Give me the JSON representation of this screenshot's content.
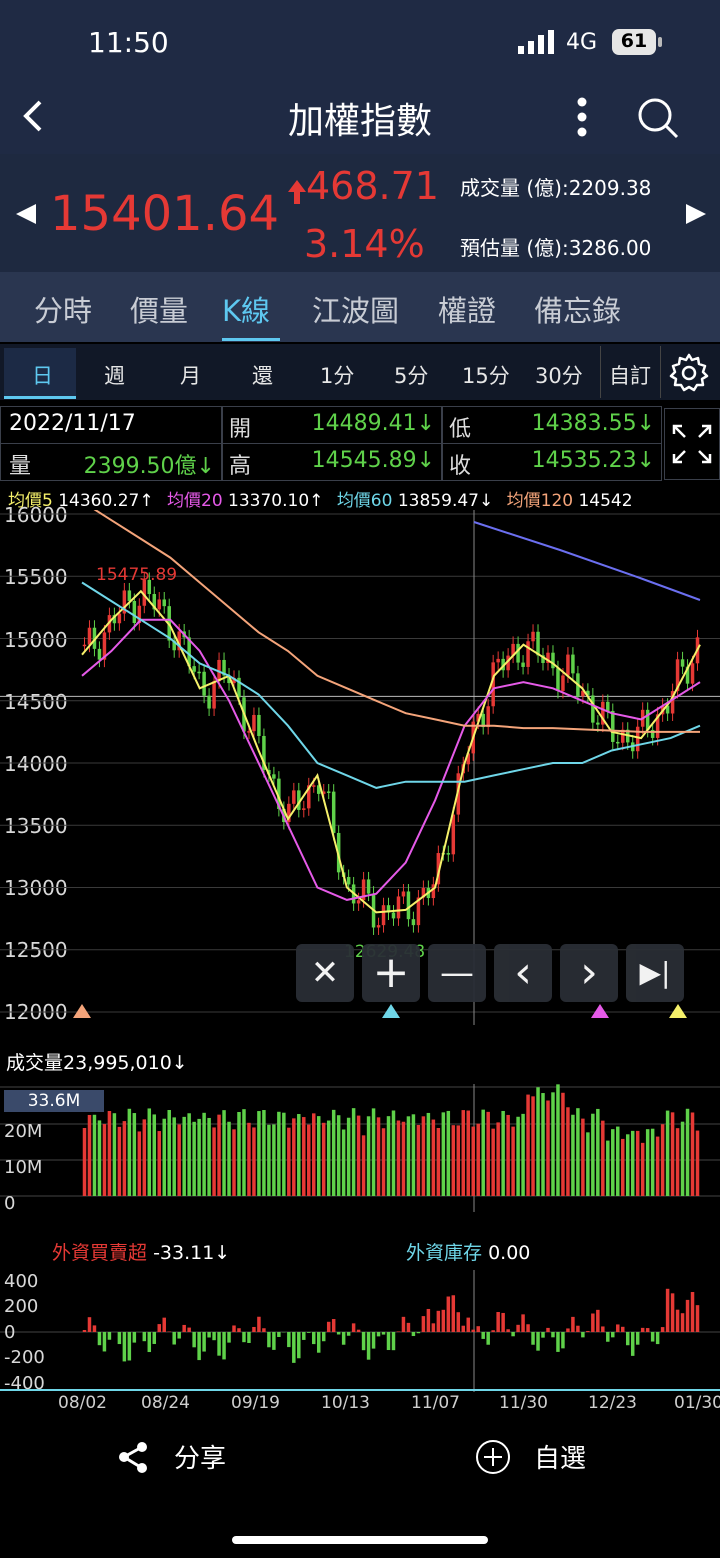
{
  "status": {
    "time": "11:50",
    "network": "4G",
    "battery": "61"
  },
  "nav": {
    "title": "加權指數"
  },
  "quote": {
    "price": "15401.64",
    "change": "468.71",
    "change_pct": "3.14%",
    "volume_label": "成交量 (億):2209.38",
    "estimate_label": "預估量 (億):3286.00"
  },
  "tabs": [
    {
      "label": "分時"
    },
    {
      "label": "價量"
    },
    {
      "label": "K線"
    },
    {
      "label": "江波圖"
    },
    {
      "label": "權證"
    },
    {
      "label": "備忘錄"
    }
  ],
  "periods": [
    {
      "label": "日"
    },
    {
      "label": "週"
    },
    {
      "label": "月"
    },
    {
      "label": "還"
    },
    {
      "label": "1分"
    },
    {
      "label": "5分"
    },
    {
      "label": "15分"
    },
    {
      "label": "30分"
    },
    {
      "label": "自訂"
    }
  ],
  "info": {
    "date": "2022/11/17",
    "open_label": "開",
    "open_value": "14489.41↓",
    "low_label": "低",
    "low_value": "14383.55↓",
    "vol_label": "量",
    "vol_value": "2399.50億↓",
    "high_label": "高",
    "high_value": "14545.89↓",
    "close_label": "收",
    "close_value": "14535.23↓"
  },
  "ma": [
    {
      "label": "均價5",
      "value": "14360.27↑",
      "color": "#f5f06a"
    },
    {
      "label": "均價20",
      "value": "13370.10↑",
      "color": "#e55ae8"
    },
    {
      "label": "均價60",
      "value": "13859.47↓",
      "color": "#6fd6e8"
    },
    {
      "label": "均價120",
      "value": "14542",
      "color": "#f4a47a"
    }
  ],
  "price_axis": [
    "16000",
    "15500",
    "15000",
    "14500",
    "14000",
    "13500",
    "13000",
    "12500",
    "12000"
  ],
  "markers": {
    "high": "15475.89",
    "low": "12629.48"
  },
  "controls": [
    {
      "symbol": "✕"
    },
    {
      "symbol": "+"
    },
    {
      "symbol": "—"
    },
    {
      "symbol": "‹"
    },
    {
      "symbol": "›"
    },
    {
      "symbol": "▶|"
    }
  ],
  "volume": {
    "label": "成交量",
    "value": "23,995,010↓",
    "cursor": "33.6M",
    "axis": [
      "20M",
      "10M",
      "0"
    ]
  },
  "foreign": {
    "label": "外資買賣超",
    "value": "-33.11↓",
    "stock_label": "外資庫存",
    "stock_value": "0.00",
    "axis": [
      "400",
      "200",
      "0",
      "-200",
      "-400"
    ]
  },
  "xaxis": [
    "08/02",
    "08/24",
    "09/19",
    "10/13",
    "11/07",
    "11/30",
    "12/23",
    "01/30"
  ],
  "bottom": {
    "share": "分享",
    "watch": "自選"
  },
  "chart_data": {
    "type": "line",
    "title": "",
    "series": [
      {
        "name": "均價5",
        "values": [
          14870,
          15150,
          15380,
          15100,
          14600,
          14700,
          14100,
          13550,
          13900,
          13000,
          12800,
          12820,
          13000,
          14000,
          14700,
          14950,
          14800,
          14600,
          14250,
          14200,
          14500,
          14950
        ]
      },
      {
        "name": "均價20",
        "values": [
          14700,
          14900,
          15150,
          15150,
          14900,
          14500,
          14000,
          13500,
          13000,
          12900,
          12950,
          13200,
          13700,
          14300,
          14600,
          14650,
          14600,
          14500,
          14400,
          14350,
          14500,
          14650
        ]
      },
      {
        "name": "均價60",
        "values": [
          15450,
          15300,
          15150,
          15000,
          14800,
          14700,
          14550,
          14300,
          14000,
          13900,
          13800,
          13850,
          13850,
          13850,
          13900,
          13950,
          14000,
          14000,
          14100,
          14150,
          14200,
          14300
        ]
      },
      {
        "name": "均價120",
        "values": [
          16100,
          15950,
          15800,
          15650,
          15450,
          15250,
          15050,
          14900,
          14700,
          14600,
          14500,
          14400,
          14350,
          14300,
          14300,
          14280,
          14280,
          14270,
          14260,
          14250,
          14250,
          14250
        ]
      }
    ],
    "ylim": [
      12000,
      16000
    ]
  }
}
